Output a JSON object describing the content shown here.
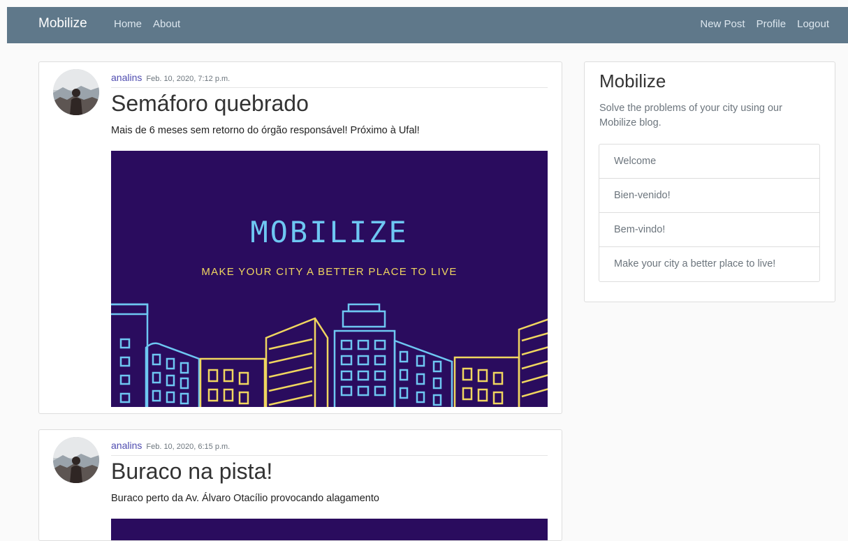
{
  "navbar": {
    "brand": "Mobilize",
    "left_links": [
      "Home",
      "About"
    ],
    "right_links": [
      "New Post",
      "Profile",
      "Logout"
    ],
    "background": "#5f788a"
  },
  "posts": [
    {
      "author": "analins",
      "date": "Feb. 10, 2020, 7:12 p.m.",
      "title": "Semáforo quebrado",
      "content": "Mais de 6 meses sem retorno do órgão responsável! Próximo à Ufal!",
      "image": {
        "title": "MOBILIZE",
        "subtitle": "MAKE YOUR CITY A BETTER PLACE TO LIVE",
        "background": "#2a0c5e"
      }
    },
    {
      "author": "analins",
      "date": "Feb. 10, 2020, 6:15 p.m.",
      "title": "Buraco na pista!",
      "content": "Buraco perto da Av. Álvaro Otacílio provocando alagamento"
    }
  ],
  "sidebar": {
    "title": "Mobilize",
    "description": "Solve the problems of your city using our Mobilize blog.",
    "items": [
      "Welcome",
      "Bien-venido!",
      "Bem-vindo!",
      "Make your city a better place to live!"
    ]
  }
}
